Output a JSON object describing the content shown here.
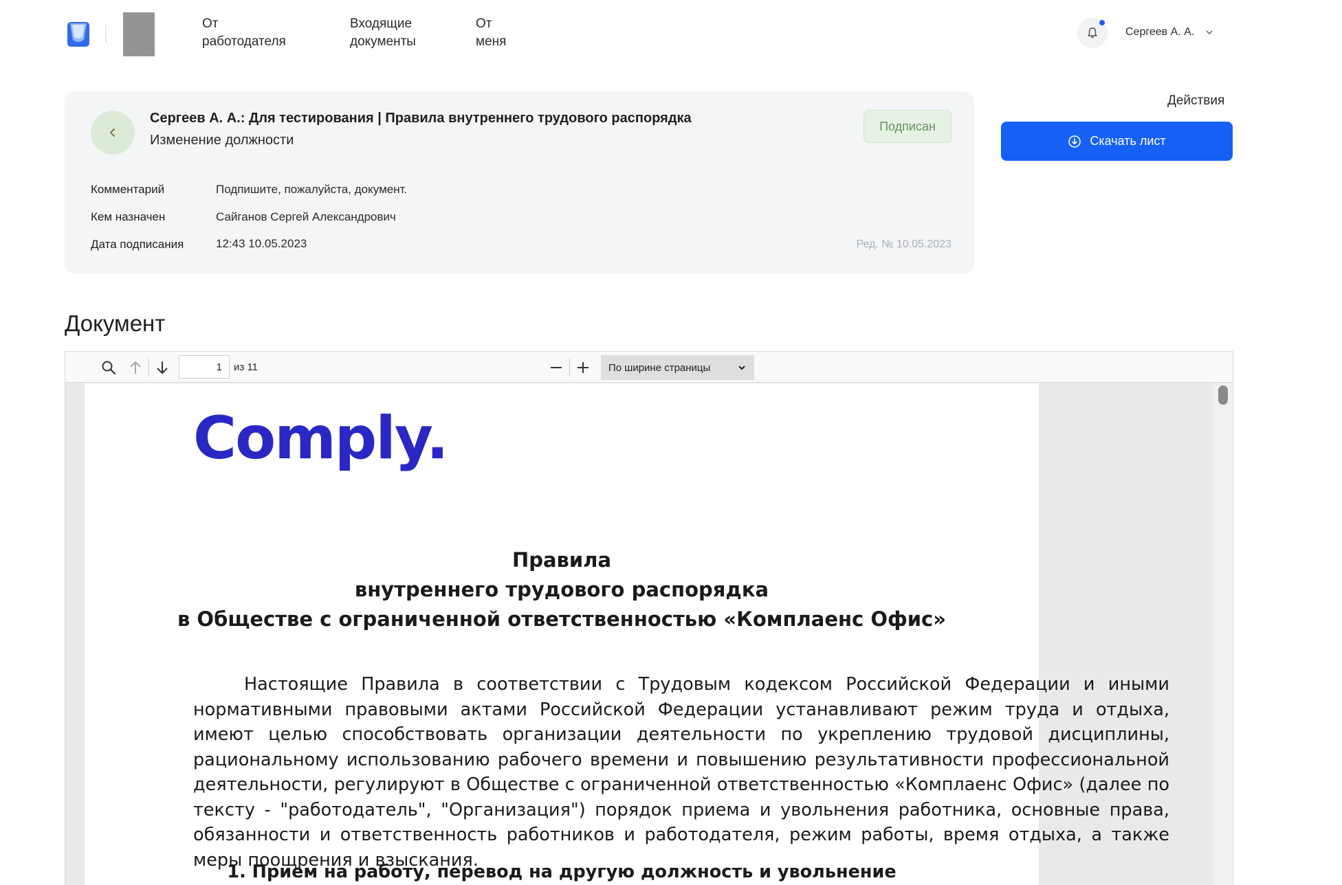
{
  "header": {
    "nav": [
      {
        "label": "От\nработодателя"
      },
      {
        "label": "Входящие\nдокументы"
      },
      {
        "label": "От\nменя"
      }
    ],
    "user": {
      "name": "Сергеев А. А."
    },
    "icons": {
      "logo": "app-logo",
      "bell": "bell-icon",
      "chevron": "chevron-down-icon"
    }
  },
  "card": {
    "title": "Сергеев А. А.: Для тестирования | Правила внутреннего трудового распорядка",
    "subtitle": "Изменение должности",
    "status": "Подписан",
    "meta": [
      {
        "label": "Комментарий",
        "value": "Подпишите, пожалуйста, документ."
      },
      {
        "label": "Кем назначен",
        "value": "Сайганов Сергей Александрович"
      },
      {
        "label": "Дата подписания",
        "value": "12:43 10.05.2023"
      }
    ],
    "edition": "Ред. № 10.05.2023"
  },
  "actions": {
    "label": "Действия",
    "download": "Скачать лист"
  },
  "document": {
    "heading": "Документ",
    "viewer": {
      "page_value": "1",
      "page_of": "из 11",
      "zoom": "По ширине страницы"
    },
    "content": {
      "logo": "Comply.",
      "title_lines": [
        "Правила",
        "внутреннего трудового распорядка",
        "в Обществе с ограниченной ответственностью «Комплаенс Офис»"
      ],
      "paragraph": "Настоящие Правила в соответствии с Трудовым кодексом Российской Федерации и иными нормативными правовыми актами Российской Федерации устанавливают режим труда и отдыха, имеют целью способствовать организации деятельности по укреплению трудовой дисциплины, рациональному использованию рабочего времени и повышению результативности профессиональной деятельности, регулируют в Обществе с ограниченной ответственностью «Комплаенс Офис» (далее по тексту - \"работодатель\", \"Организация\") порядок приема и увольнения работника, основные права, обязанности и ответственность работников и работодателя, режим работы, время отдыха, а также меры поощрения и взыскания.",
      "section": "1. Прием на работу, перевод на другую должность и увольнение"
    }
  },
  "colors": {
    "primary": "#1660f5",
    "status_bg": "#e5f1e2",
    "status_text": "#6b8f66",
    "card_bg": "#f4f5f7",
    "comply_brand": "#2a28c4"
  }
}
